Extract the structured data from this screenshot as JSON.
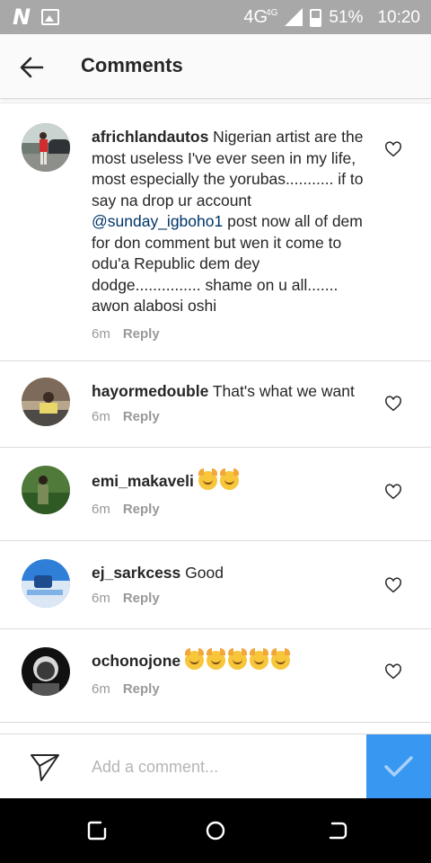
{
  "status_bar": {
    "network": "4G",
    "network_sup": "4G",
    "battery": "51%",
    "time": "10:20"
  },
  "header": {
    "title": "Comments",
    "back_icon": "arrow-left-icon"
  },
  "comments": [
    {
      "username": "africhlandautos",
      "text_before": " Nigerian artist are the most useless I've ever seen in my life, most especially the yorubas........... if to say na drop ur account ",
      "mention": "@sunday_igboho1",
      "text_after": " post now all of dem for don comment but wen it come to odu'a Republic dem dey dodge............... shame on u all....... awon alabosi oshi",
      "time": "6m",
      "reply": "Reply"
    },
    {
      "username": "hayormedouble",
      "text": " That's what we want",
      "time": "6m",
      "reply": "Reply"
    },
    {
      "username": "emi_makaveli",
      "emoji_count": 2,
      "emoji_icon": "raising-hands-emoji",
      "time": "6m",
      "reply": "Reply"
    },
    {
      "username": "ej_sarkcess",
      "text": " Good",
      "time": "6m",
      "reply": "Reply"
    },
    {
      "username": "ochonojone",
      "emoji_count": 5,
      "emoji_icon": "raising-hands-emoji",
      "time": "6m",
      "reply": "Reply"
    }
  ],
  "compose": {
    "placeholder": "Add a comment...",
    "send_icon": "paper-plane-icon",
    "post_icon": "checkmark-icon"
  },
  "colors": {
    "accent": "#3897f0",
    "status_bar": "#a8a8a8",
    "mention": "#003569",
    "muted": "#999999"
  }
}
